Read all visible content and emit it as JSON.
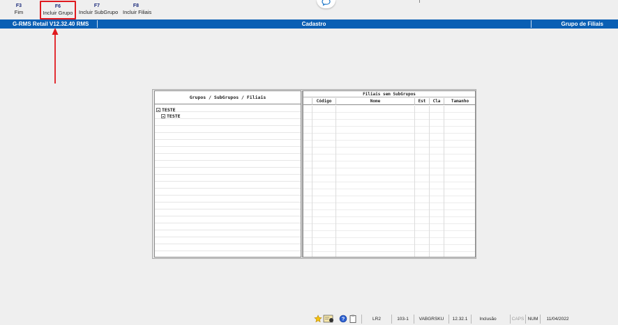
{
  "function_keys": [
    {
      "code": "F3",
      "label": "Fim"
    },
    {
      "code": "F6",
      "label": "Incluir Grupo"
    },
    {
      "code": "F7",
      "label": "Incluir SubGrupo"
    },
    {
      "code": "F8",
      "label": "Incluir Filiais"
    }
  ],
  "titlebar": {
    "app": "G-RMS Retail V12.32.40 RMS",
    "module": "Cadastro",
    "screen": "Grupo de Filiais"
  },
  "tree_panel": {
    "header": "Grupos / SubGrupos / Filiais",
    "nodes": [
      "TESTE",
      "TESTE"
    ]
  },
  "grid_panel": {
    "title": "Filiais sem SubGrupos",
    "columns": [
      "",
      "Código",
      "Nome",
      "Est",
      "Cla",
      "Tamanho"
    ]
  },
  "statusbar": {
    "cells": [
      "LR2",
      "103-1",
      "VABGRSKU",
      "12.32.1",
      "Inclusão",
      "CAPS",
      "NUM",
      "11/04/2022"
    ]
  },
  "colors": {
    "titlebar_bg": "#0a5fb4",
    "highlight_border": "#e0191e",
    "annotation_arrow": "#e0191e"
  }
}
